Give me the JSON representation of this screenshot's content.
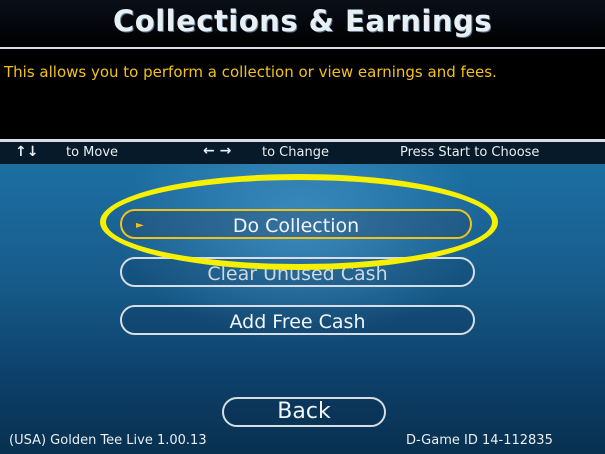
{
  "header": {
    "title": "Collections & Earnings"
  },
  "description": "This allows you to perform a collection or view earnings and fees.",
  "help": {
    "move_icon": "up-down-arrows-icon",
    "move_text": "to Move",
    "change_icon": "left-right-arrows-icon",
    "change_text": "to Change",
    "start_text": "Press Start to Choose"
  },
  "menu": {
    "items": [
      {
        "label": "Do Collection",
        "selected": true
      },
      {
        "label": "Clear Unused Cash",
        "selected": false
      },
      {
        "label": "Add Free Cash",
        "selected": false
      }
    ],
    "back_label": "Back"
  },
  "footer": {
    "version": "(USA) Golden Tee Live 1.00.13",
    "game_id": "D-Game ID 14-112835"
  },
  "colors": {
    "title": "#e8f0f6",
    "description_text": "#f3c21a",
    "selected_border": "#f0c21c",
    "highlight_ring": "#f7f000",
    "background_blue": "#1d6fa3"
  }
}
